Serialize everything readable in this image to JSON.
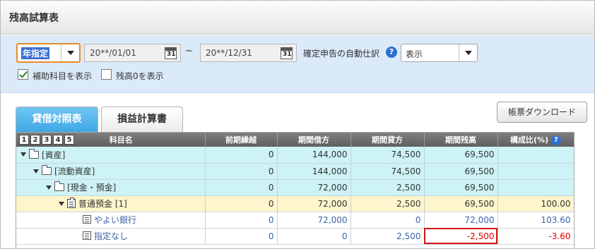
{
  "window": {
    "title": "残高試算表"
  },
  "filters": {
    "period_select": "年指定",
    "date_from": "20**/01/01",
    "date_to": "20**/12/31",
    "tilde": "~",
    "cal_glyph": "31",
    "auto_label": "確定申告の自動仕訳",
    "help_glyph": "?",
    "auto_select": "表示",
    "show_sub_label": "補助科目を表示",
    "show_sub_checked": true,
    "show_zero_label": "残高0を表示",
    "show_zero_checked": false
  },
  "tabs": [
    {
      "label": "貸借対照表",
      "active": true
    },
    {
      "label": "損益計算書",
      "active": false
    }
  ],
  "download_button": "帳票ダウンロード",
  "table": {
    "level_buttons": [
      "1",
      "2",
      "3",
      "4",
      "5"
    ],
    "headers": [
      "科目名",
      "前期繰越",
      "期間借方",
      "期間貸方",
      "期間残高",
      "構成比(%)"
    ],
    "rows": [
      {
        "name": "[資産]",
        "prev": "0",
        "debit": "144,000",
        "credit": "74,500",
        "balance": "69,500",
        "ratio": ""
      },
      {
        "name": "[流動資産]",
        "prev": "0",
        "debit": "144,000",
        "credit": "74,500",
        "balance": "69,500",
        "ratio": ""
      },
      {
        "name": "[現金・預金]",
        "prev": "0",
        "debit": "72,000",
        "credit": "2,500",
        "balance": "69,500",
        "ratio": ""
      },
      {
        "name": "普通預金 [1]",
        "prev": "0",
        "debit": "72,000",
        "credit": "2,500",
        "balance": "69,500",
        "ratio": "100.00"
      },
      {
        "name": "やよい銀行",
        "prev": "0",
        "debit": "72,000",
        "credit": "0",
        "balance": "72,000",
        "ratio": "103.60"
      },
      {
        "name": "指定なし",
        "prev": "0",
        "debit": "0",
        "credit": "2,500",
        "balance": "-2,500",
        "ratio": "-3.60"
      }
    ]
  },
  "colors": {
    "accent_tab": "#3ea6e4",
    "filter_bg": "#dbeaf8",
    "group_row": "#cdf3f6",
    "account_row": "#fff5cc",
    "negative": "#e00000"
  }
}
